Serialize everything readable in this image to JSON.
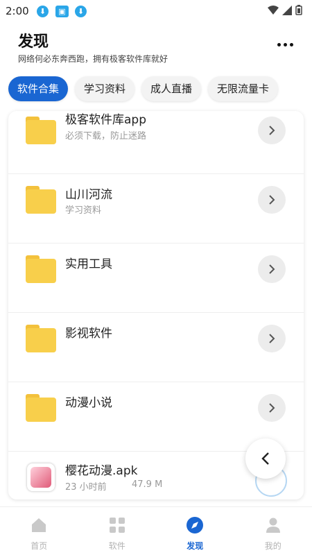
{
  "status_bar": {
    "time": "2:00"
  },
  "header": {
    "title": "发现",
    "subtitle": "网络何必东奔西跑，拥有极客软件库就好"
  },
  "tabs": [
    {
      "label": "软件合集",
      "active": true
    },
    {
      "label": "学习资料",
      "active": false
    },
    {
      "label": "成人直播",
      "active": false
    },
    {
      "label": "无限流量卡",
      "active": false
    }
  ],
  "list": {
    "folders": [
      {
        "title": "极客软件库app",
        "subtitle": "必须下载，防止迷路"
      },
      {
        "title": "山川河流",
        "subtitle": "学习资料"
      },
      {
        "title": "实用工具",
        "subtitle": ""
      },
      {
        "title": "影视软件",
        "subtitle": ""
      },
      {
        "title": "动漫小说",
        "subtitle": ""
      }
    ],
    "apk": {
      "title": "樱花动漫.apk",
      "time": "23 小时前",
      "size": "47.9 M"
    }
  },
  "bottom_nav": [
    {
      "label": "首页",
      "icon": "home-icon",
      "active": false
    },
    {
      "label": "软件",
      "icon": "grid-icon",
      "active": false
    },
    {
      "label": "发现",
      "icon": "compass-icon",
      "active": true
    },
    {
      "label": "我的",
      "icon": "person-icon",
      "active": false
    }
  ],
  "colors": {
    "accent": "#1a66d2",
    "folder": "#f8cf4b",
    "nav_inactive": "#b2b2b2"
  }
}
